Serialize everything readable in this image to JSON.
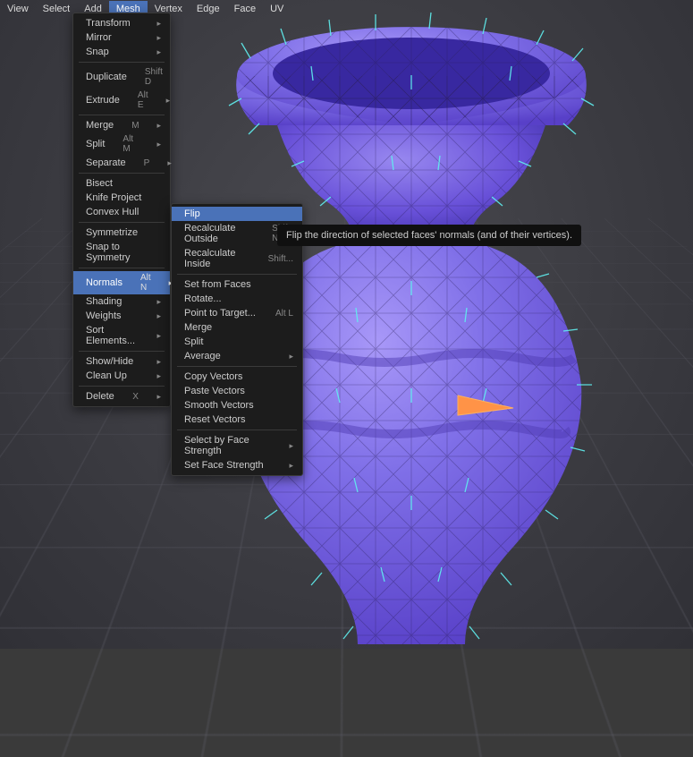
{
  "menubar": {
    "items": [
      "View",
      "Select",
      "Add",
      "Mesh",
      "Vertex",
      "Edge",
      "Face",
      "UV"
    ],
    "active": "Mesh"
  },
  "mesh_menu": {
    "items": [
      {
        "label": "Transform",
        "arrow": true
      },
      {
        "label": "Mirror",
        "arrow": true
      },
      {
        "label": "Snap",
        "arrow": true
      },
      {
        "sep": true
      },
      {
        "label": "Duplicate",
        "shortcut": "Shift D"
      },
      {
        "label": "Extrude",
        "shortcut": "Alt E",
        "arrow": true
      },
      {
        "sep": true
      },
      {
        "label": "Merge",
        "shortcut": "M",
        "arrow": true
      },
      {
        "label": "Split",
        "shortcut": "Alt M",
        "arrow": true
      },
      {
        "label": "Separate",
        "shortcut": "P",
        "arrow": true
      },
      {
        "sep": true
      },
      {
        "label": "Bisect"
      },
      {
        "label": "Knife Project"
      },
      {
        "label": "Convex Hull"
      },
      {
        "sep": true
      },
      {
        "label": "Symmetrize"
      },
      {
        "label": "Snap to Symmetry"
      },
      {
        "sep": true
      },
      {
        "label": "Normals",
        "shortcut": "Alt N",
        "arrow": true,
        "highlighted": true
      },
      {
        "label": "Shading",
        "arrow": true
      },
      {
        "label": "Weights",
        "arrow": true
      },
      {
        "label": "Sort Elements...",
        "arrow": true
      },
      {
        "sep": true
      },
      {
        "label": "Show/Hide",
        "arrow": true
      },
      {
        "label": "Clean Up",
        "arrow": true
      },
      {
        "sep": true
      },
      {
        "label": "Delete",
        "shortcut": "X",
        "arrow": true
      }
    ]
  },
  "normals_menu": {
    "items": [
      {
        "label": "Flip",
        "highlighted": true
      },
      {
        "label": "Recalculate Outside",
        "shortcut": "Shift N"
      },
      {
        "label": "Recalculate Inside",
        "shortcut": "Shift..."
      },
      {
        "sep": true
      },
      {
        "label": "Set from Faces"
      },
      {
        "label": "Rotate..."
      },
      {
        "label": "Point to Target...",
        "shortcut": "Alt L"
      },
      {
        "label": "Merge"
      },
      {
        "label": "Split"
      },
      {
        "label": "Average",
        "arrow": true
      },
      {
        "sep": true
      },
      {
        "label": "Copy Vectors"
      },
      {
        "label": "Paste Vectors"
      },
      {
        "label": "Smooth Vectors"
      },
      {
        "label": "Reset Vectors"
      },
      {
        "sep": true
      },
      {
        "label": "Select by Face Strength",
        "arrow": true
      },
      {
        "label": "Set Face Strength",
        "arrow": true
      }
    ]
  },
  "tooltip": {
    "text": "Flip the direction of selected faces' normals (and of their vertices)."
  },
  "scene": {
    "object": "vase",
    "normals_visible": true,
    "selected_face_color": "#ff9347",
    "vase_color": "#7860e8",
    "normal_color": "#60f0f0"
  }
}
